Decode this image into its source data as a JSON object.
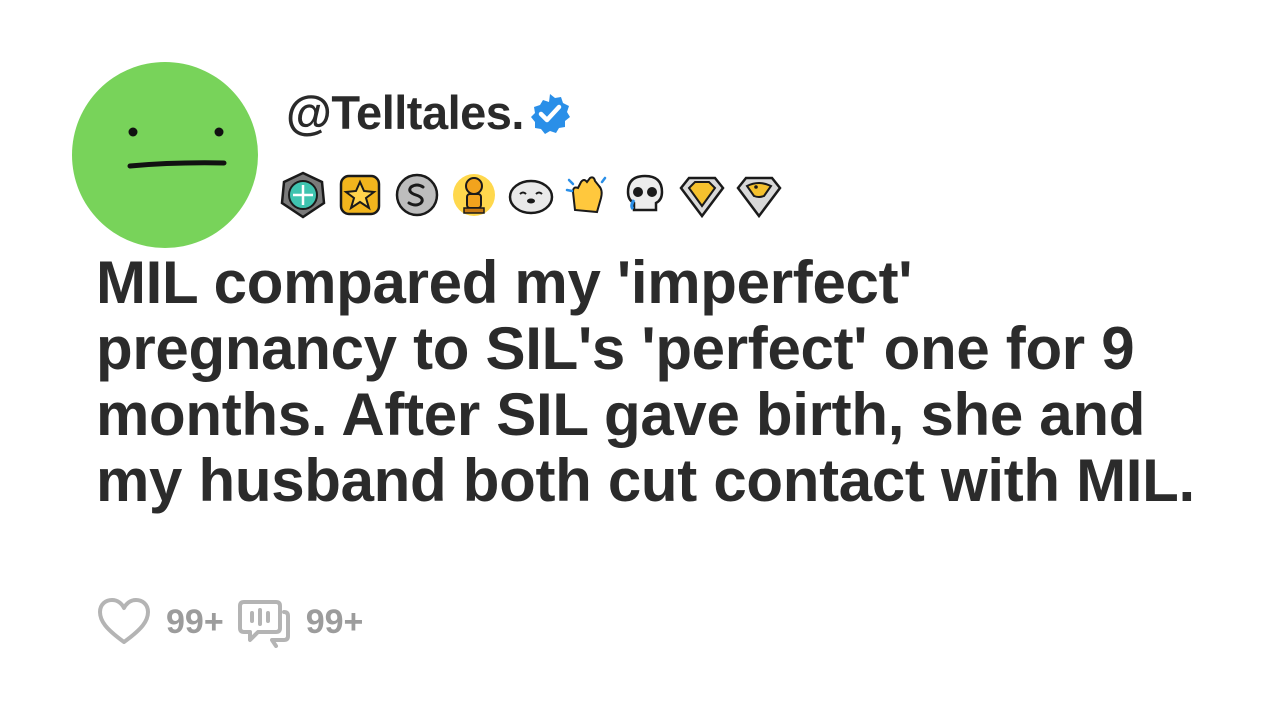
{
  "profile": {
    "handle": "@Telltales.",
    "avatar_color": "#78d35a",
    "verified_color": "#2a8fe8",
    "verified_icon": "verified-check-icon"
  },
  "badges": [
    "gem-award-icon",
    "gold-star-award-icon",
    "silver-coin-award-icon",
    "gold-trophy-award-icon",
    "seal-award-icon",
    "clapping-hands-award-icon",
    "crying-skull-award-icon",
    "diamond-award-icon",
    "pelican-award-icon"
  ],
  "post": {
    "title": "MIL compared my 'imperfect' pregnancy to SIL's 'perfect' one for 9 months. After SIL gave birth, she and my husband both cut contact with MIL."
  },
  "actions": {
    "likes": "99+",
    "comments": "99+"
  }
}
